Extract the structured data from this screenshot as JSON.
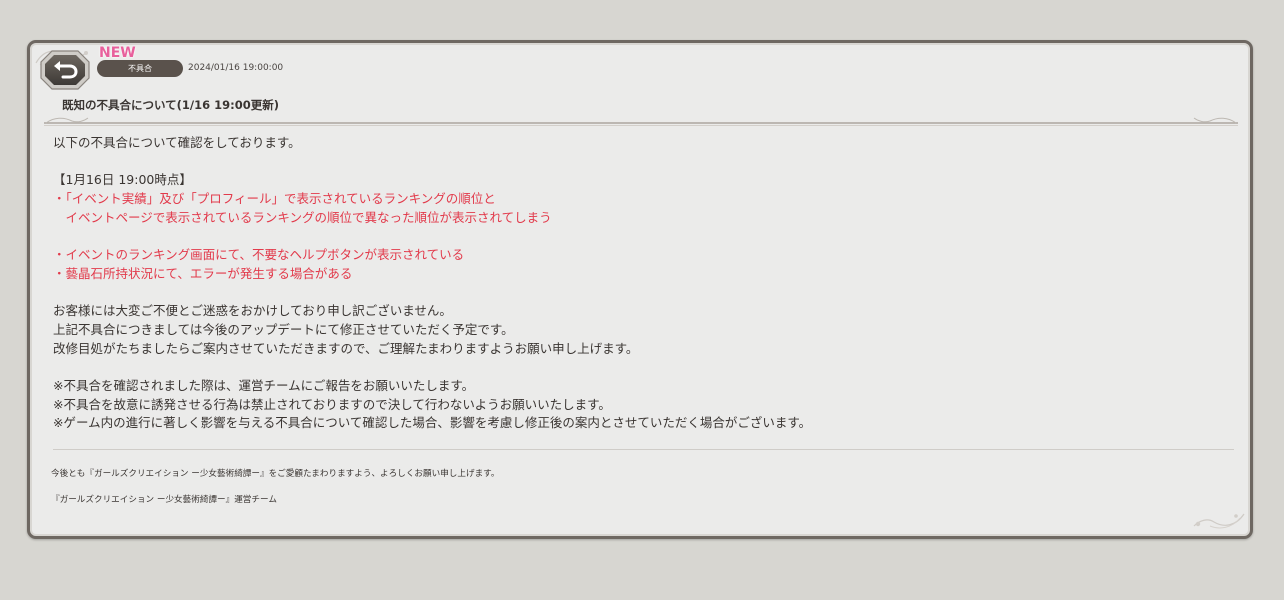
{
  "notice": {
    "new_label": "NEW",
    "category": "不具合",
    "datetime": "2024/01/16 19:00:00",
    "title": "既知の不具合について(1/16 19:00更新)"
  },
  "body": {
    "lines": [
      {
        "text": "以下の不具合について確認をしております。",
        "color": "normal"
      },
      {
        "text": "",
        "color": "normal"
      },
      {
        "text": "【1月16日 19:00時点】",
        "color": "normal"
      },
      {
        "text": "・「イベント実績」及び「プロフィール」で表示されているランキングの順位と",
        "color": "red"
      },
      {
        "text": "　イベントページで表示されているランキングの順位で異なった順位が表示されてしまう",
        "color": "red"
      },
      {
        "text": "",
        "color": "normal"
      },
      {
        "text": "・イベントのランキング画面にて、不要なヘルプボタンが表示されている",
        "color": "red"
      },
      {
        "text": "・藝晶石所持状況にて、エラーが発生する場合がある",
        "color": "red"
      },
      {
        "text": "",
        "color": "normal"
      },
      {
        "text": "お客様には大変ご不便とご迷惑をおかけしており申し訳ございません。",
        "color": "normal"
      },
      {
        "text": "上記不具合につきましては今後のアップデートにて修正させていただく予定です。",
        "color": "normal"
      },
      {
        "text": "改修目処がたちましたらご案内させていただきますので、ご理解たまわりますようお願い申し上げます。",
        "color": "normal"
      },
      {
        "text": "",
        "color": "normal"
      },
      {
        "text": "※不具合を確認されました際は、運営チームにご報告をお願いいたします。",
        "color": "normal"
      },
      {
        "text": "※不具合を故意に誘発させる行為は禁止されておりますので決して行わないようお願いいたします。",
        "color": "normal"
      },
      {
        "text": "※ゲーム内の進行に著しく影響を与える不具合について確認した場合、影響を考慮し修正後の案内とさせていただく場合がございます。",
        "color": "normal"
      }
    ]
  },
  "footer": {
    "message": "今後とも『ガールズクリエイション ー少女藝術綺譚ー』をご愛顧たまわりますよう、よろしくお願い申し上げます。",
    "signature": "『ガールズクリエイション ー少女藝術綺譚ー』運営チーム"
  },
  "icons": {
    "back": "back-arrow-icon"
  },
  "colors": {
    "background": "#d7d6d1",
    "panel": "#ebebea",
    "panel_border": "#6e6862",
    "accent_red": "#e23a4b",
    "new_pink": "#e8609c",
    "pill": "#5a524c"
  }
}
